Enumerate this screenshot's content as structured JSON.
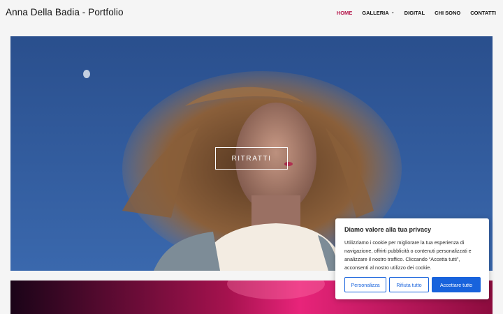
{
  "header": {
    "site_title": "Anna Della Badia - Portfolio",
    "nav": [
      {
        "label": "HOME",
        "active": true
      },
      {
        "label": "GALLERIA",
        "active": false,
        "dropdown": true
      },
      {
        "label": "DIGITAL",
        "active": false
      },
      {
        "label": "CHI SONO",
        "active": false
      },
      {
        "label": "CONTATTI",
        "active": false
      }
    ]
  },
  "hero": {
    "button_label": "RITRATTI"
  },
  "cookie_banner": {
    "title": "Diamo valore alla tua privacy",
    "text": "Utilizziamo i cookie per migliorare la tua esperienza di navigazione, offrirti pubblicità o contenuti personalizzati e analizzare il nostro traffico. Cliccando “Accetta tutti”, acconsenti al nostro utilizzo dei cookie.",
    "buttons": {
      "customize": "Personalizza",
      "reject": "Rifiuta tutto",
      "accept": "Accettare tutto"
    }
  },
  "colors": {
    "accent": "#b5174b",
    "cookie_blue": "#1863dc",
    "sky": "#2b4f8c"
  },
  "icons": {
    "dropdown": "chevron-down-icon"
  }
}
